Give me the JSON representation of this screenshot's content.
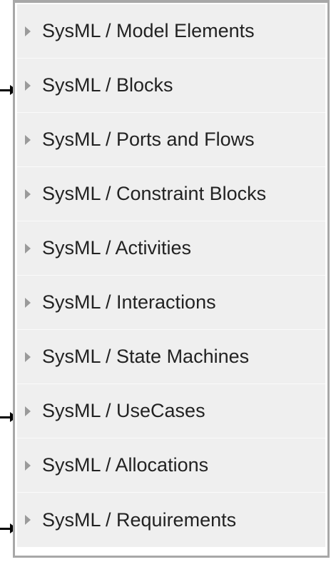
{
  "tree": {
    "items": [
      {
        "label": "SysML / Model Elements",
        "icon": "collapsed-triangle-icon"
      },
      {
        "label": "SysML / Blocks",
        "icon": "collapsed-triangle-icon"
      },
      {
        "label": "SysML / Ports and Flows",
        "icon": "collapsed-triangle-icon"
      },
      {
        "label": "SysML / Constraint Blocks",
        "icon": "collapsed-triangle-icon"
      },
      {
        "label": "SysML / Activities",
        "icon": "collapsed-triangle-icon"
      },
      {
        "label": "SysML / Interactions",
        "icon": "collapsed-triangle-icon"
      },
      {
        "label": "SysML / State Machines",
        "icon": "collapsed-triangle-icon"
      },
      {
        "label": "SysML / UseCases",
        "icon": "collapsed-triangle-icon"
      },
      {
        "label": "SysML / Allocations",
        "icon": "collapsed-triangle-icon"
      },
      {
        "label": "SysML / Requirements",
        "icon": "collapsed-triangle-icon"
      }
    ],
    "pointed_items": [
      "SysML / Blocks",
      "SysML / UseCases",
      "SysML / Requirements"
    ]
  },
  "colors": {
    "panel_background": "#efefef",
    "border": "#a8a8a8",
    "triangle": "#9a9a9a",
    "text": "#222222",
    "arrow": "#000000"
  }
}
